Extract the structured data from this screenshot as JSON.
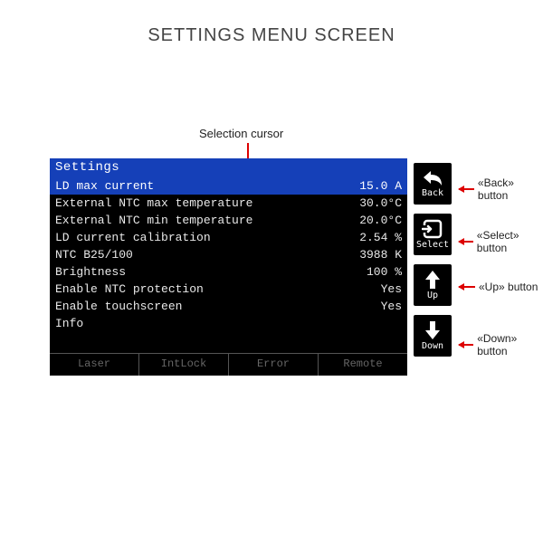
{
  "page_title": "SETTINGS MENU SCREEN",
  "cursor_label": "Selection cursor",
  "screen": {
    "title": "Settings",
    "rows": [
      {
        "label": "LD max current",
        "value": "15.0 A",
        "selected": true
      },
      {
        "label": "External NTC max temperature",
        "value": "30.0°C",
        "selected": false
      },
      {
        "label": "External NTC min temperature",
        "value": "20.0°C",
        "selected": false
      },
      {
        "label": "LD current calibration",
        "value": "2.54 %",
        "selected": false
      },
      {
        "label": "NTC B25/100",
        "value": "3988 K",
        "selected": false
      },
      {
        "label": "Brightness",
        "value": "100 %",
        "selected": false
      },
      {
        "label": "Enable NTC protection",
        "value": "Yes",
        "selected": false
      },
      {
        "label": "Enable touchscreen",
        "value": "Yes",
        "selected": false
      },
      {
        "label": "Info",
        "value": "",
        "selected": false
      }
    ],
    "status": [
      "Laser",
      "IntLock",
      "Error",
      "Remote"
    ]
  },
  "buttons": {
    "back": {
      "label": "Back"
    },
    "select": {
      "label": "Select"
    },
    "up": {
      "label": "Up"
    },
    "down": {
      "label": "Down"
    }
  },
  "callouts": {
    "back": "«Back» button",
    "select": "«Select» button",
    "up": "«Up» button",
    "down": "«Down» button"
  }
}
